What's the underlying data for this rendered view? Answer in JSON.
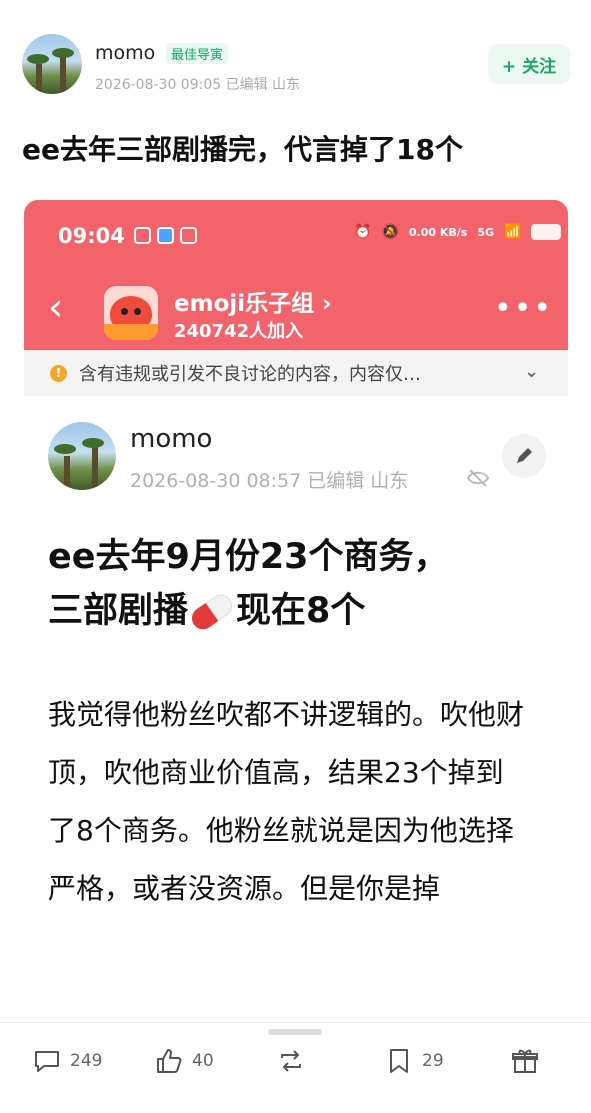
{
  "post": {
    "username": "momo",
    "badge": "最佳导寅",
    "meta": "2026-08-30 09:05  已编辑  山东",
    "follow_label": "+ 关注",
    "title": "ee去年三部剧播完，代言掉了18个"
  },
  "screenshot": {
    "status_time": "09:04",
    "status_speed": "0.00 KB/s",
    "status_net": "5G",
    "group_name": "emoji乐子组 ›",
    "group_count": "240742人加入",
    "warning_text": "含有违规或引发不良讨论的内容，内容仅…",
    "inner_username": "momo",
    "inner_meta": "2026-08-30 08:57  已编辑  山东",
    "inner_title_line1": "ee去年9月份23个商务，",
    "inner_title_line2_a": "三部剧播",
    "inner_title_line2_b": "现在8个",
    "inner_body": "我觉得他粉丝吹都不讲逻辑的。吹他财顶，吹他商业价值高，结果23个掉到了8个商务。他粉丝就说是因为他选择严格，或者没资源。但是你是掉"
  },
  "actions": {
    "comments": "249",
    "likes": "40",
    "collects": "29"
  },
  "colors": {
    "accent_green": "#1aa867",
    "screenshot_header": "#f2636b"
  }
}
